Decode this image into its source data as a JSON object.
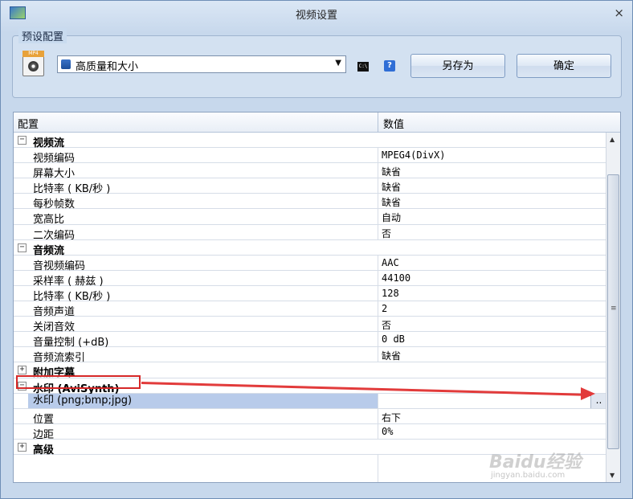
{
  "window": {
    "title": "视频设置",
    "close_glyph": "×"
  },
  "preset": {
    "group_label": "预设配置",
    "icon_tag": "MP4",
    "selected": "高质量和大小",
    "cmd_label": "C:\\",
    "help_label": "?",
    "save_as_label": "另存为",
    "ok_label": "确定"
  },
  "grid": {
    "columns": [
      "配置",
      "数值"
    ],
    "rows": [
      {
        "type": "cat",
        "name": "视频流",
        "expander": "−"
      },
      {
        "type": "item",
        "name": "视频编码",
        "value": "MPEG4(DivX)"
      },
      {
        "type": "item",
        "name": "屏幕大小",
        "value": "缺省"
      },
      {
        "type": "item",
        "name": "比特率 ( KB/秒 )",
        "value": "缺省"
      },
      {
        "type": "item",
        "name": "每秒帧数",
        "value": "缺省"
      },
      {
        "type": "item",
        "name": "宽高比",
        "value": "自动"
      },
      {
        "type": "item",
        "name": "二次编码",
        "value": "否"
      },
      {
        "type": "cat",
        "name": "音频流",
        "expander": "−"
      },
      {
        "type": "item",
        "name": "音视频编码",
        "value": "AAC"
      },
      {
        "type": "item",
        "name": "采样率 ( 赫兹 )",
        "value": "44100"
      },
      {
        "type": "item",
        "name": "比特率 ( KB/秒 )",
        "value": "128"
      },
      {
        "type": "item",
        "name": "音频声道",
        "value": "2"
      },
      {
        "type": "item",
        "name": "关闭音效",
        "value": "否"
      },
      {
        "type": "item",
        "name": "音量控制 (+dB)",
        "value": "0 dB"
      },
      {
        "type": "item",
        "name": "音频流索引",
        "value": "缺省"
      },
      {
        "type": "cat",
        "name": "附加字幕",
        "expander": "+"
      },
      {
        "type": "cat",
        "name": "水印 (AviSynth)",
        "expander": "−"
      },
      {
        "type": "sel",
        "name": "水印 (png;bmp;jpg)",
        "value": "",
        "button": ".."
      },
      {
        "type": "item",
        "name": "位置",
        "value": "右下"
      },
      {
        "type": "item",
        "name": "边距",
        "value": "0%"
      },
      {
        "type": "cat",
        "name": "高级",
        "expander": "+"
      }
    ]
  },
  "scrollbar": {
    "up": "▲",
    "down": "▼",
    "grip": "≡"
  },
  "watermark": {
    "brand": "Baidu经验",
    "url": "jingyan.baidu.com"
  },
  "colors": {
    "annotation": "#e23b3b",
    "selection": "#b8cbea"
  }
}
